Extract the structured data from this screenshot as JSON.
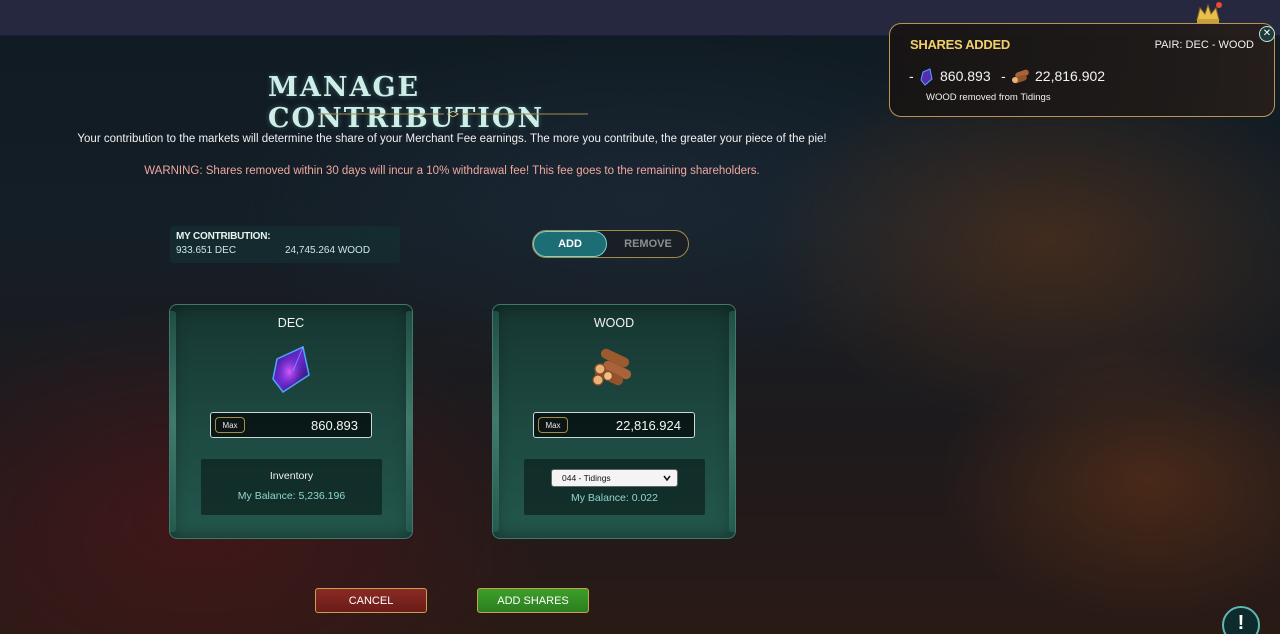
{
  "title": "MANAGE CONTRIBUTION",
  "intro_text": "Your contribution to the markets will determine the share of your Merchant Fee earnings. The more you contribute, the greater your piece of the pie!",
  "warning_text": "WARNING: Shares removed within 30 days will incur a 10% withdrawal fee! This fee goes to the remaining shareholders.",
  "contribution": {
    "label": "MY CONTRIBUTION:",
    "dec": "933.651 DEC",
    "wood": "24,745.264 WOOD"
  },
  "mode_toggle": {
    "add_label": "ADD",
    "remove_label": "REMOVE",
    "selected": "ADD"
  },
  "dec_card": {
    "name": "DEC",
    "max_label": "Max",
    "amount": "860.893",
    "inventory_label": "Inventory",
    "balance": "My Balance: 5,236.196"
  },
  "wood_card": {
    "name": "WOOD",
    "max_label": "Max",
    "amount": "22,816.924",
    "source_select": "044 - Tidings",
    "balance": "My Balance: 0.022"
  },
  "buttons": {
    "cancel": "CANCEL",
    "add_shares": "ADD SHARES"
  },
  "toast": {
    "title": "SHARES ADDED",
    "pair": "PAIR: DEC - WOOD",
    "dash1": "-",
    "dec_amount": "860.893",
    "dash2": "-",
    "wood_amount": "22,816.902",
    "note": "WOOD removed from Tidings",
    "close_icon": "close-icon"
  },
  "help_badge": "!",
  "colors": {
    "accent_teal": "#1c6d74",
    "gold_border": "#b89550",
    "toast_title": "#f3cf6a",
    "warning": "#f0a7a0",
    "cancel": "#8a2a24",
    "add_shares": "#3c9f2a"
  }
}
